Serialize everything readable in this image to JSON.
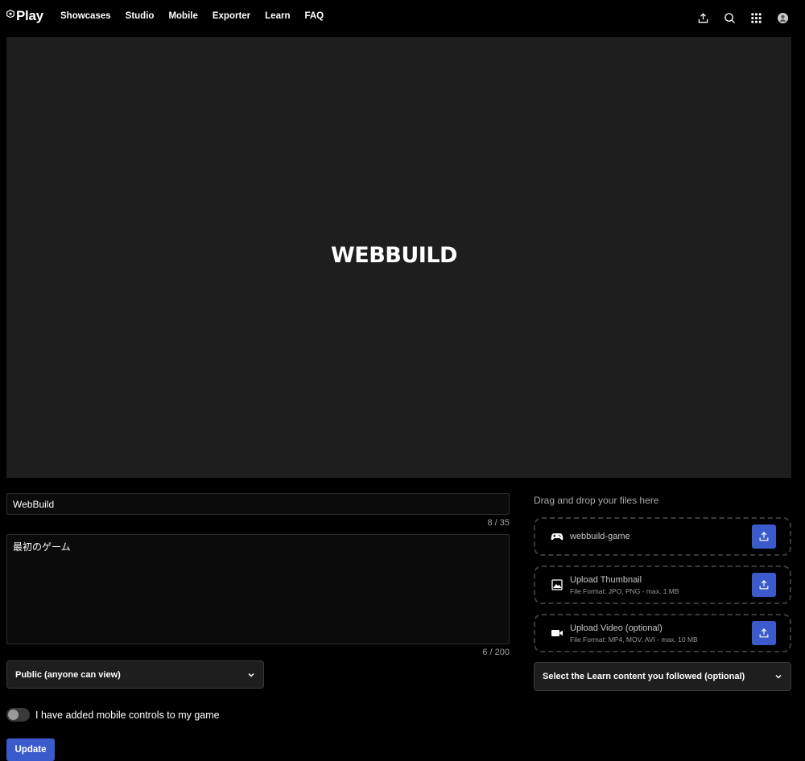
{
  "header": {
    "logo_text": "Play",
    "nav": [
      "Showcases",
      "Studio",
      "Mobile",
      "Exporter",
      "Learn",
      "FAQ"
    ],
    "icons": [
      "upload-icon",
      "search-icon",
      "apps-grid-icon",
      "account-avatar-icon"
    ]
  },
  "preview": {
    "title": "WEBBUILD"
  },
  "form": {
    "title_value": "WebBuild",
    "title_counter": "8 / 35",
    "description_value": "最初のゲーム",
    "description_counter": "6 / 200",
    "visibility_selected": "Public (anyone can view)",
    "mobile_controls_label": "I have added mobile controls to my game",
    "mobile_controls_enabled": false,
    "update_label": "Update"
  },
  "uploads": {
    "dropzone_label": "Drag and drop your files here",
    "build": {
      "name": "webbuild-game",
      "icon": "gamepad-icon"
    },
    "thumbnail": {
      "name": "Upload Thumbnail",
      "format": "File Format: JPO, PNG - max. 1 MB",
      "icon": "image-icon"
    },
    "video": {
      "name": "Upload Video (optional)",
      "format": "File Format: MP4, MOV, AVI - max. 10 MB",
      "icon": "video-camera-icon"
    },
    "learn_select": "Select the Learn content you followed (optional)"
  },
  "colors": {
    "background": "#000000",
    "panel": "#1e1e1e",
    "accent": "#3b5bcc"
  }
}
